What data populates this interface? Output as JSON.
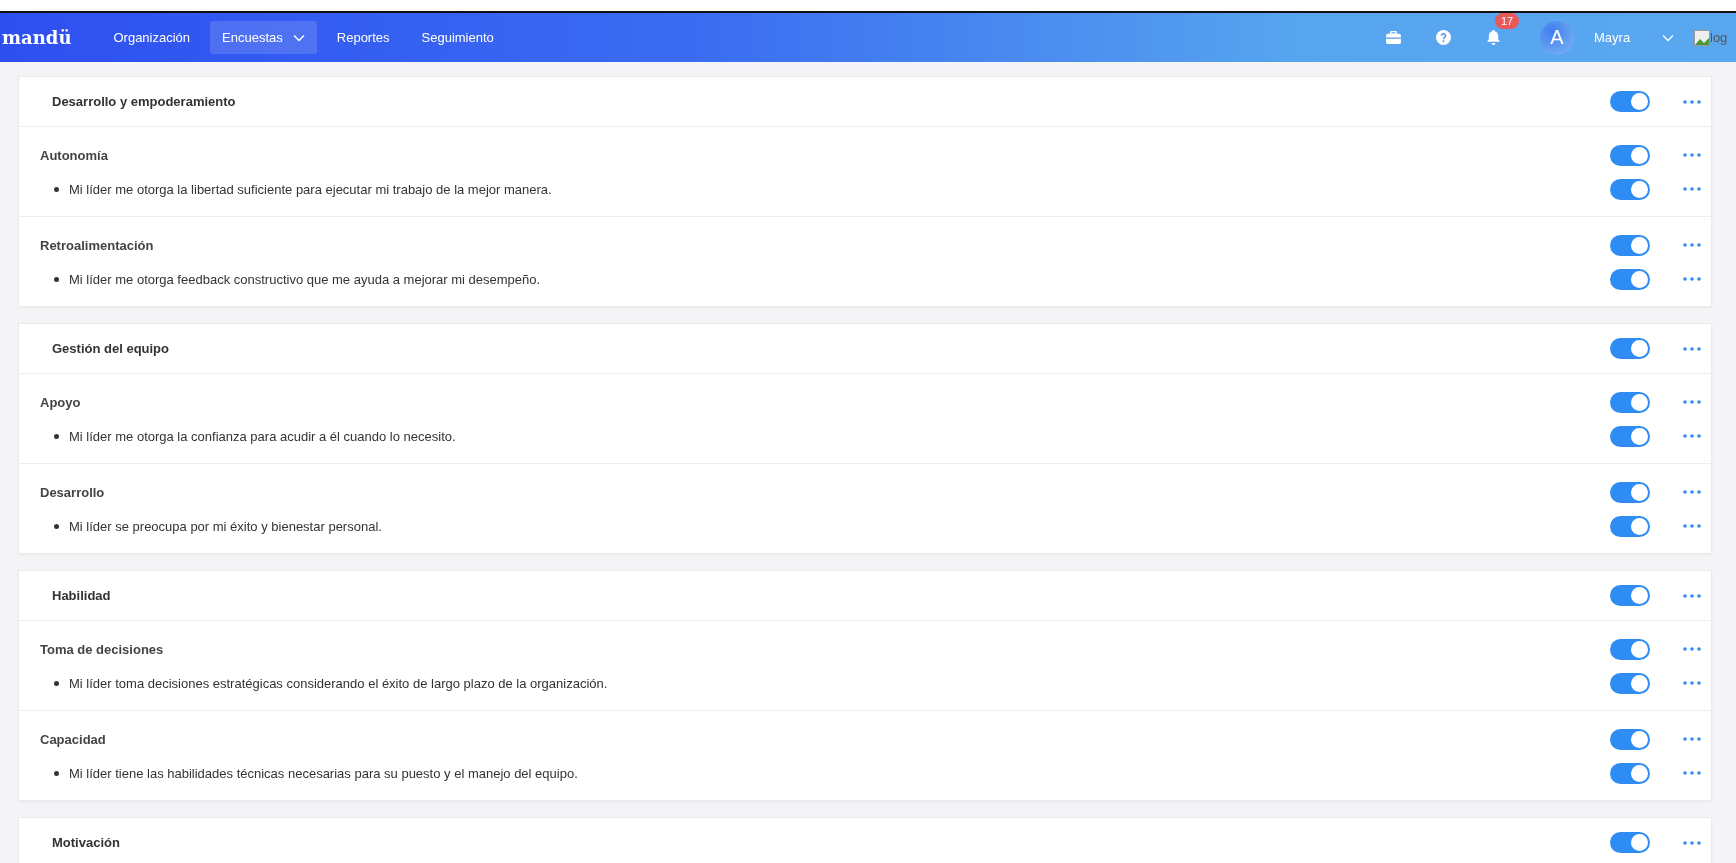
{
  "nav": {
    "brand": "mandü",
    "links": [
      {
        "label": "Organización",
        "selected": false,
        "dropdown": false
      },
      {
        "label": "Encuestas",
        "selected": true,
        "dropdown": true
      },
      {
        "label": "Reportes",
        "selected": false,
        "dropdown": false
      },
      {
        "label": "Seguimiento",
        "selected": false,
        "dropdown": false
      }
    ],
    "notification_count": "17",
    "avatar_letter": "A",
    "user_name": "Mayra",
    "logo_alt": "log"
  },
  "sections": [
    {
      "title": "Desarrollo y empoderamiento",
      "enabled": true,
      "groups": [
        {
          "title": "Autonomía",
          "enabled": true,
          "items": [
            {
              "text": "Mi líder me otorga la libertad suficiente para ejecutar mi trabajo de la mejor manera.",
              "enabled": true
            }
          ]
        },
        {
          "title": "Retroalimentación",
          "enabled": true,
          "items": [
            {
              "text": "Mi líder me otorga feedback constructivo que me ayuda a mejorar mi desempeño.",
              "enabled": true
            }
          ]
        }
      ]
    },
    {
      "title": "Gestión del equipo",
      "enabled": true,
      "groups": [
        {
          "title": "Apoyo",
          "enabled": true,
          "items": [
            {
              "text": "Mi líder me otorga la confianza para acudir a él cuando lo necesito.",
              "enabled": true
            }
          ]
        },
        {
          "title": "Desarrollo",
          "enabled": true,
          "items": [
            {
              "text": "Mi líder se preocupa por mi éxito y bienestar personal.",
              "enabled": true
            }
          ]
        }
      ]
    },
    {
      "title": "Habilidad",
      "enabled": true,
      "groups": [
        {
          "title": "Toma de decisiones",
          "enabled": true,
          "items": [
            {
              "text": "Mi líder toma decisiones estratégicas considerando el éxito de largo plazo de la organización.",
              "enabled": true
            }
          ]
        },
        {
          "title": "Capacidad",
          "enabled": true,
          "items": [
            {
              "text": "Mi líder tiene las habilidades técnicas necesarias para su puesto y el manejo del equipo.",
              "enabled": true
            }
          ]
        }
      ]
    },
    {
      "title": "Motivación",
      "enabled": true
    }
  ]
}
